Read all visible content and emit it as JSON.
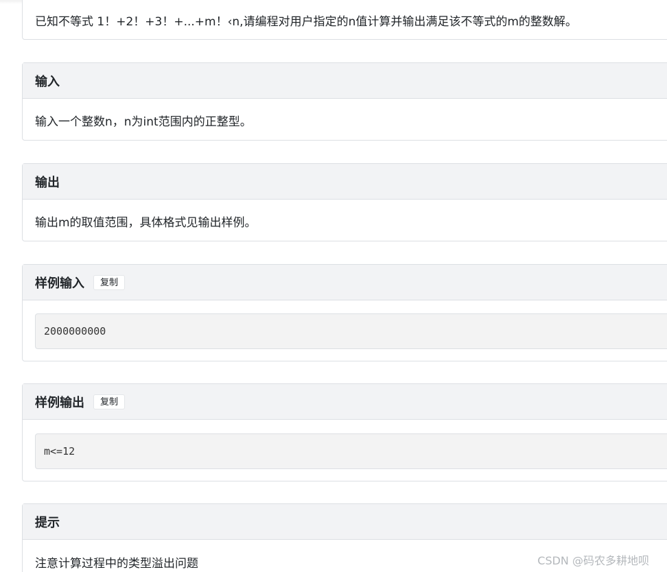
{
  "description": {
    "text": "已知不等式 1！+2！+3！+...+m！‹n,请编程对用户指定的n值计算并输出满足该不等式的m的整数解。"
  },
  "input_section": {
    "title": "输入",
    "text": "输入一个整数n，n为int范围内的正整型。"
  },
  "output_section": {
    "title": "输出",
    "text": "输出m的取值范围，具体格式见输出样例。"
  },
  "sample_input": {
    "title": "样例输入",
    "copy_label": "复制",
    "code": "2000000000"
  },
  "sample_output": {
    "title": "样例输出",
    "copy_label": "复制",
    "code": "m<=12"
  },
  "hint_section": {
    "title": "提示",
    "text": "注意计算过程中的类型溢出问题"
  },
  "watermark": {
    "text": "CSDN @码农多耕地呗"
  }
}
